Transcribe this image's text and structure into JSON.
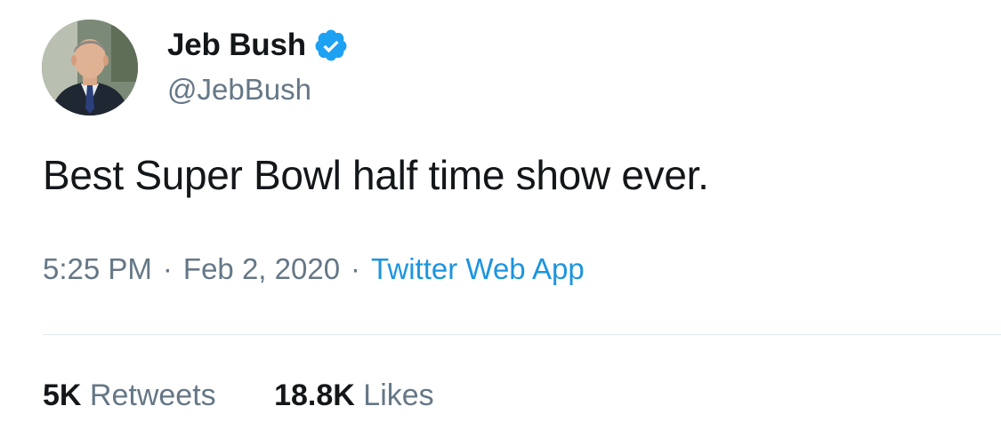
{
  "user": {
    "display_name": "Jeb Bush",
    "handle": "@JebBush",
    "verified": true
  },
  "tweet": {
    "text": "Best Super Bowl half time show ever.",
    "time": "5:25 PM",
    "separator": "·",
    "date": "Feb 2, 2020",
    "source": "Twitter Web App"
  },
  "stats": {
    "retweets_count": "5K",
    "retweets_label": "Retweets",
    "likes_count": "18.8K",
    "likes_label": "Likes"
  },
  "colors": {
    "accent": "#1da1f2",
    "source_link": "#1b95e0",
    "secondary_text": "#657786",
    "primary_text": "#14171a",
    "divider": "#e1e8ed"
  },
  "icons": {
    "verified": "verified-badge-icon"
  }
}
